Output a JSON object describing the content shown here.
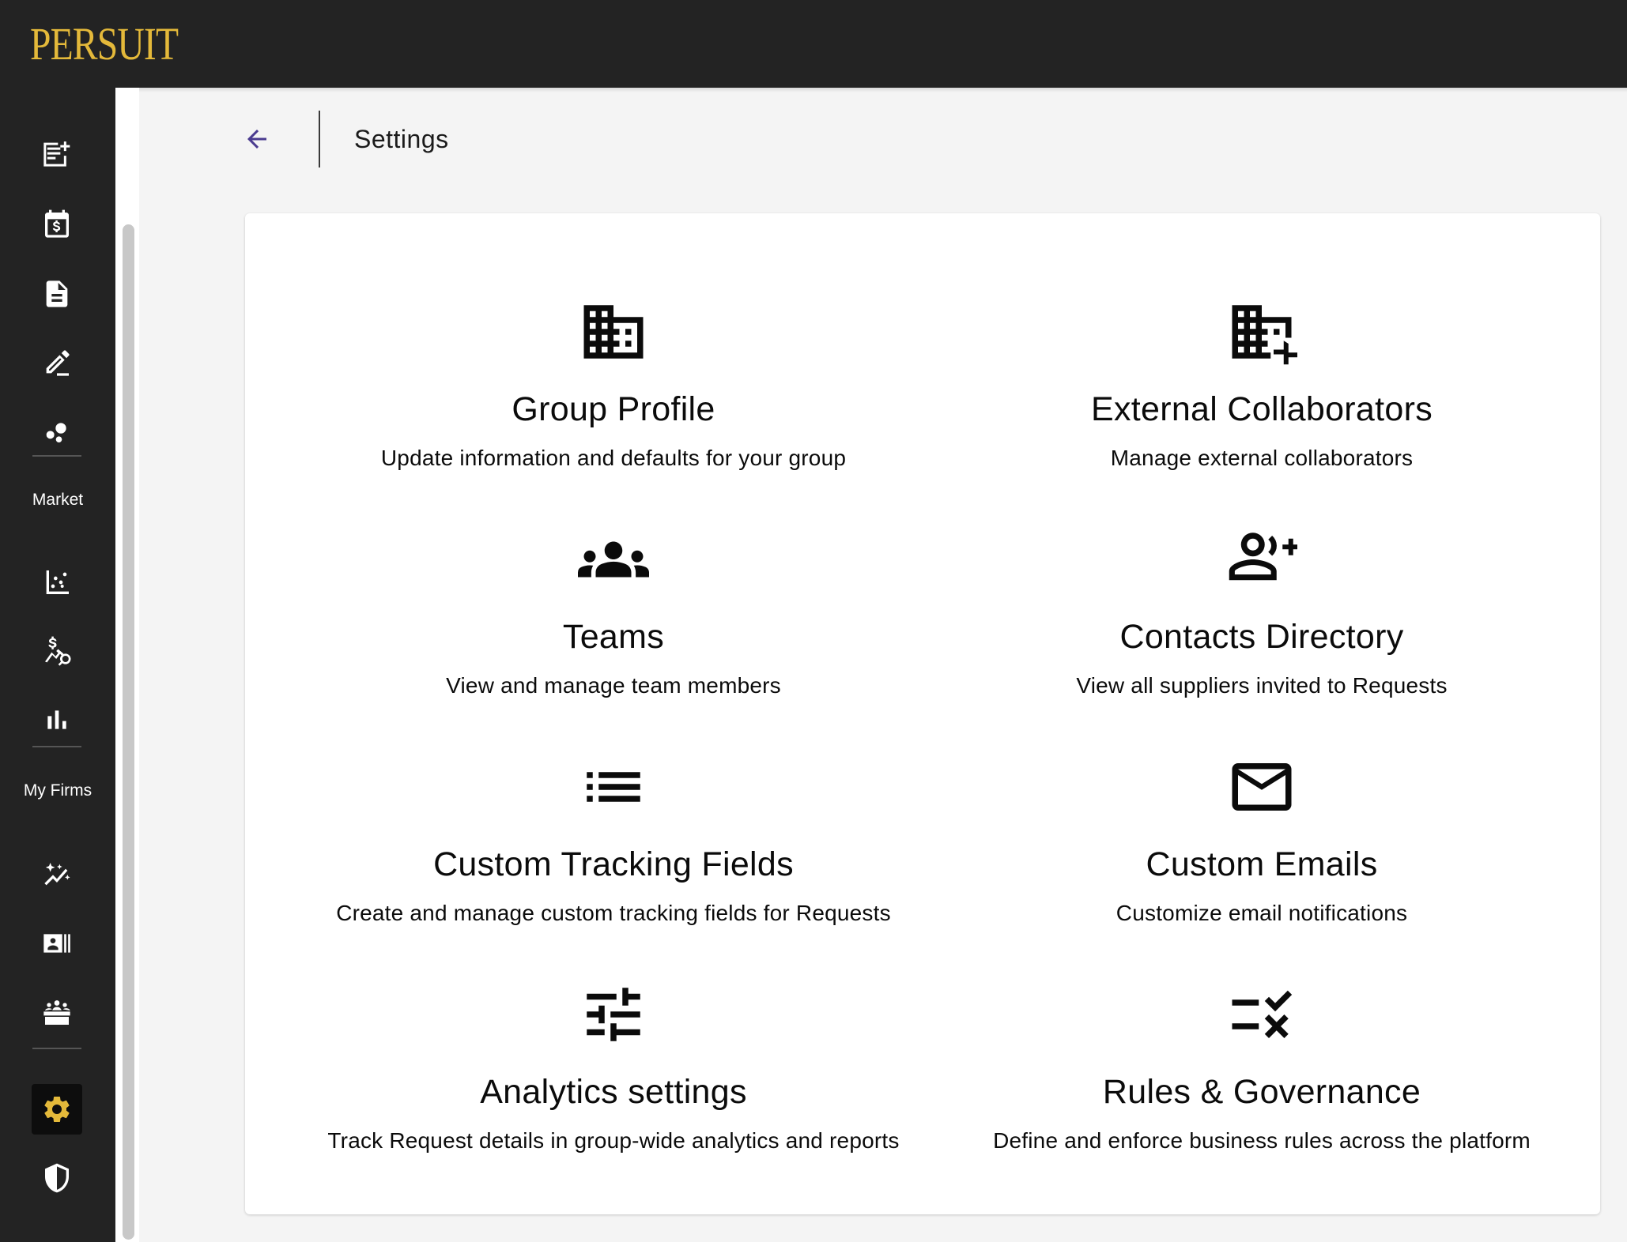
{
  "app": {
    "brand": "PERSUIT"
  },
  "sidebar": {
    "sections": [
      "Market",
      "My Firms"
    ],
    "icons": [
      "new-request-icon",
      "calendar-dollar-icon",
      "document-icon",
      "edit-icon",
      "bubbles-icon",
      "scatter-chart-icon",
      "price-search-icon",
      "bar-chart-icon",
      "sparkle-trend-icon",
      "contact-card-icon",
      "team-table-icon",
      "settings-icon",
      "shield-icon"
    ],
    "active_item": "settings"
  },
  "header": {
    "title": "Settings",
    "back_icon": "arrow-back-icon"
  },
  "tiles": [
    {
      "title": "Group Profile",
      "description": "Update information and defaults for your group",
      "icon": "building-icon"
    },
    {
      "title": "External Collaborators",
      "description": "Manage external collaborators",
      "icon": "building-add-icon"
    },
    {
      "title": "Teams",
      "description": "View and manage team members",
      "icon": "groups-icon"
    },
    {
      "title": "Contacts Directory",
      "description": "View all suppliers invited to Requests",
      "icon": "person-add-icon"
    },
    {
      "title": "Custom Tracking Fields",
      "description": "Create and manage custom tracking fields for Requests",
      "icon": "list-icon"
    },
    {
      "title": "Custom Emails",
      "description": "Customize email notifications",
      "icon": "mail-icon"
    },
    {
      "title": "Analytics settings",
      "description": "Track Request details in group-wide analytics and reports",
      "icon": "tune-icon"
    },
    {
      "title": "Rules & Governance",
      "description": "Define and enforce business rules across the platform",
      "icon": "rule-icon"
    }
  ],
  "colors": {
    "topbar": "#232323",
    "brand_gold": "#e4b93a",
    "back_arrow": "#4a3b8f",
    "page_bg": "#f4f4f4",
    "card_bg": "#ffffff"
  }
}
